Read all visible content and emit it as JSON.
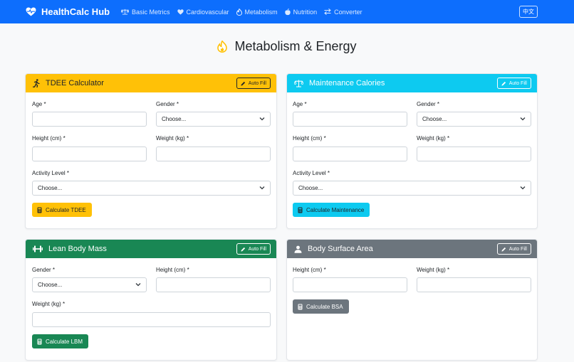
{
  "nav": {
    "brand": "HealthCalc Hub",
    "links": [
      {
        "label": "Basic Metrics",
        "icon": "scale-icon"
      },
      {
        "label": "Cardiovascular",
        "icon": "heart-icon"
      },
      {
        "label": "Metabolism",
        "icon": "fire-icon"
      },
      {
        "label": "Nutrition",
        "icon": "apple-icon"
      },
      {
        "label": "Converter",
        "icon": "arrows-icon"
      }
    ],
    "lang_button": "中文"
  },
  "page": {
    "title": "Metabolism & Energy"
  },
  "common": {
    "auto_fill": "Auto Fill",
    "choose": "Choose..."
  },
  "cards": {
    "tdee": {
      "title": "TDEE Calculator",
      "labels": {
        "age": "Age *",
        "gender": "Gender *",
        "height": "Height (cm) *",
        "weight": "Weight (kg) *",
        "activity": "Activity Level *"
      },
      "button": "Calculate TDEE"
    },
    "maintenance": {
      "title": "Maintenance Calories",
      "labels": {
        "age": "Age *",
        "gender": "Gender *",
        "height": "Height (cm) *",
        "weight": "Weight (kg) *",
        "activity": "Activity Level *"
      },
      "button": "Calculate Maintenance"
    },
    "lbm": {
      "title": "Lean Body Mass",
      "labels": {
        "gender": "Gender *",
        "height": "Height (cm) *",
        "weight": "Weight (kg) *"
      },
      "button": "Calculate LBM"
    },
    "bsa": {
      "title": "Body Surface Area",
      "labels": {
        "height": "Height (cm) *",
        "weight": "Weight (kg) *"
      },
      "button": "Calculate BSA"
    }
  },
  "colors": {
    "primary": "#0d6efd",
    "warning": "#ffc107",
    "info": "#0dcaf0",
    "success": "#198754",
    "secondary": "#6c757d"
  }
}
